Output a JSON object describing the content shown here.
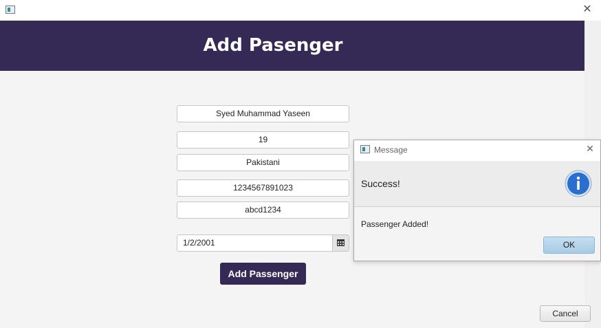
{
  "window": {
    "icon": "app-window-icon",
    "close_icon": "close-icon"
  },
  "header": {
    "title": "Add Pasenger"
  },
  "form": {
    "name": "Syed Muhammad Yaseen",
    "age": "19",
    "nationality": "Pakistani",
    "cnic": "1234567891023",
    "password": "abcd1234",
    "date": "1/2/2001",
    "date_icon": "calendar-icon",
    "add_button": "Add Passenger"
  },
  "footer": {
    "cancel_button": "Cancel"
  },
  "dialog": {
    "title": "Message",
    "header_text": "Success!",
    "content_text": "Passenger Added!",
    "ok_button": "OK",
    "icon": "info-icon"
  },
  "colors": {
    "primary": "#352a55",
    "info_blue": "#2a6fcf"
  }
}
